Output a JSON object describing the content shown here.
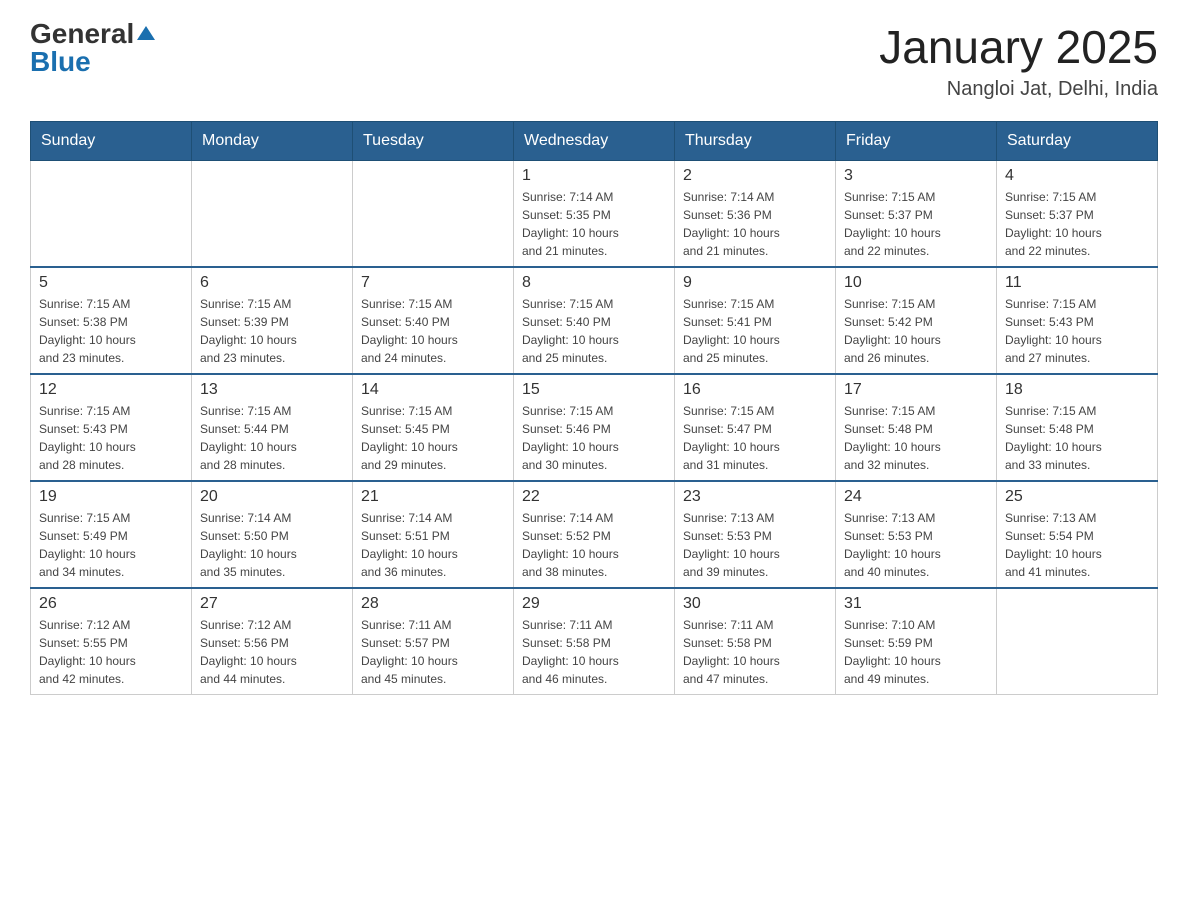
{
  "header": {
    "logo_text_general": "General",
    "logo_text_blue": "Blue",
    "title": "January 2025",
    "subtitle": "Nangloi Jat, Delhi, India"
  },
  "days_of_week": [
    "Sunday",
    "Monday",
    "Tuesday",
    "Wednesday",
    "Thursday",
    "Friday",
    "Saturday"
  ],
  "weeks": [
    {
      "days": [
        {
          "number": "",
          "info": ""
        },
        {
          "number": "",
          "info": ""
        },
        {
          "number": "",
          "info": ""
        },
        {
          "number": "1",
          "info": "Sunrise: 7:14 AM\nSunset: 5:35 PM\nDaylight: 10 hours\nand 21 minutes."
        },
        {
          "number": "2",
          "info": "Sunrise: 7:14 AM\nSunset: 5:36 PM\nDaylight: 10 hours\nand 21 minutes."
        },
        {
          "number": "3",
          "info": "Sunrise: 7:15 AM\nSunset: 5:37 PM\nDaylight: 10 hours\nand 22 minutes."
        },
        {
          "number": "4",
          "info": "Sunrise: 7:15 AM\nSunset: 5:37 PM\nDaylight: 10 hours\nand 22 minutes."
        }
      ]
    },
    {
      "days": [
        {
          "number": "5",
          "info": "Sunrise: 7:15 AM\nSunset: 5:38 PM\nDaylight: 10 hours\nand 23 minutes."
        },
        {
          "number": "6",
          "info": "Sunrise: 7:15 AM\nSunset: 5:39 PM\nDaylight: 10 hours\nand 23 minutes."
        },
        {
          "number": "7",
          "info": "Sunrise: 7:15 AM\nSunset: 5:40 PM\nDaylight: 10 hours\nand 24 minutes."
        },
        {
          "number": "8",
          "info": "Sunrise: 7:15 AM\nSunset: 5:40 PM\nDaylight: 10 hours\nand 25 minutes."
        },
        {
          "number": "9",
          "info": "Sunrise: 7:15 AM\nSunset: 5:41 PM\nDaylight: 10 hours\nand 25 minutes."
        },
        {
          "number": "10",
          "info": "Sunrise: 7:15 AM\nSunset: 5:42 PM\nDaylight: 10 hours\nand 26 minutes."
        },
        {
          "number": "11",
          "info": "Sunrise: 7:15 AM\nSunset: 5:43 PM\nDaylight: 10 hours\nand 27 minutes."
        }
      ]
    },
    {
      "days": [
        {
          "number": "12",
          "info": "Sunrise: 7:15 AM\nSunset: 5:43 PM\nDaylight: 10 hours\nand 28 minutes."
        },
        {
          "number": "13",
          "info": "Sunrise: 7:15 AM\nSunset: 5:44 PM\nDaylight: 10 hours\nand 28 minutes."
        },
        {
          "number": "14",
          "info": "Sunrise: 7:15 AM\nSunset: 5:45 PM\nDaylight: 10 hours\nand 29 minutes."
        },
        {
          "number": "15",
          "info": "Sunrise: 7:15 AM\nSunset: 5:46 PM\nDaylight: 10 hours\nand 30 minutes."
        },
        {
          "number": "16",
          "info": "Sunrise: 7:15 AM\nSunset: 5:47 PM\nDaylight: 10 hours\nand 31 minutes."
        },
        {
          "number": "17",
          "info": "Sunrise: 7:15 AM\nSunset: 5:48 PM\nDaylight: 10 hours\nand 32 minutes."
        },
        {
          "number": "18",
          "info": "Sunrise: 7:15 AM\nSunset: 5:48 PM\nDaylight: 10 hours\nand 33 minutes."
        }
      ]
    },
    {
      "days": [
        {
          "number": "19",
          "info": "Sunrise: 7:15 AM\nSunset: 5:49 PM\nDaylight: 10 hours\nand 34 minutes."
        },
        {
          "number": "20",
          "info": "Sunrise: 7:14 AM\nSunset: 5:50 PM\nDaylight: 10 hours\nand 35 minutes."
        },
        {
          "number": "21",
          "info": "Sunrise: 7:14 AM\nSunset: 5:51 PM\nDaylight: 10 hours\nand 36 minutes."
        },
        {
          "number": "22",
          "info": "Sunrise: 7:14 AM\nSunset: 5:52 PM\nDaylight: 10 hours\nand 38 minutes."
        },
        {
          "number": "23",
          "info": "Sunrise: 7:13 AM\nSunset: 5:53 PM\nDaylight: 10 hours\nand 39 minutes."
        },
        {
          "number": "24",
          "info": "Sunrise: 7:13 AM\nSunset: 5:53 PM\nDaylight: 10 hours\nand 40 minutes."
        },
        {
          "number": "25",
          "info": "Sunrise: 7:13 AM\nSunset: 5:54 PM\nDaylight: 10 hours\nand 41 minutes."
        }
      ]
    },
    {
      "days": [
        {
          "number": "26",
          "info": "Sunrise: 7:12 AM\nSunset: 5:55 PM\nDaylight: 10 hours\nand 42 minutes."
        },
        {
          "number": "27",
          "info": "Sunrise: 7:12 AM\nSunset: 5:56 PM\nDaylight: 10 hours\nand 44 minutes."
        },
        {
          "number": "28",
          "info": "Sunrise: 7:11 AM\nSunset: 5:57 PM\nDaylight: 10 hours\nand 45 minutes."
        },
        {
          "number": "29",
          "info": "Sunrise: 7:11 AM\nSunset: 5:58 PM\nDaylight: 10 hours\nand 46 minutes."
        },
        {
          "number": "30",
          "info": "Sunrise: 7:11 AM\nSunset: 5:58 PM\nDaylight: 10 hours\nand 47 minutes."
        },
        {
          "number": "31",
          "info": "Sunrise: 7:10 AM\nSunset: 5:59 PM\nDaylight: 10 hours\nand 49 minutes."
        },
        {
          "number": "",
          "info": ""
        }
      ]
    }
  ]
}
